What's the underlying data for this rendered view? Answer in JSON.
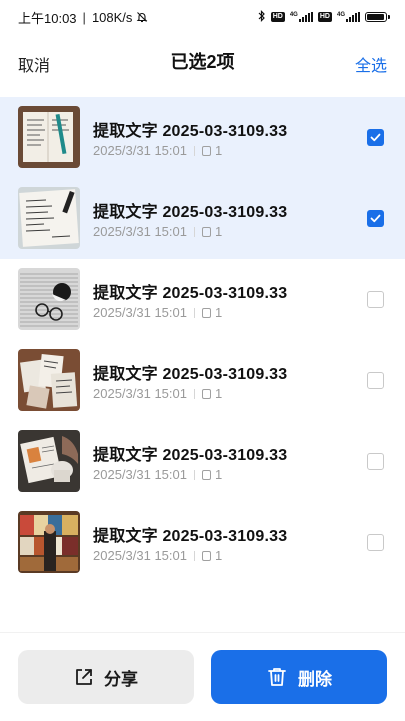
{
  "status_bar": {
    "time": "上午10:03",
    "network_speed": "108K/s",
    "icons": [
      "mute-bell-icon",
      "bluetooth-icon",
      "hd-icon",
      "signal-icon",
      "hd-icon",
      "signal-icon",
      "battery-icon"
    ],
    "signal_label": "4G"
  },
  "header": {
    "cancel_label": "取消",
    "title": "已选2项",
    "select_all_label": "全选",
    "accent_color": "#1a6fe8"
  },
  "items": [
    {
      "title": "提取文字 2025-03-3109.33",
      "date": "2025/3/31 15:01",
      "pages": "1",
      "selected": true,
      "thumb": "notebook-photo"
    },
    {
      "title": "提取文字 2025-03-3109.33",
      "date": "2025/3/31 15:01",
      "pages": "1",
      "selected": true,
      "thumb": "handwritten-notes-photo"
    },
    {
      "title": "提取文字 2025-03-3109.33",
      "date": "2025/3/31 15:01",
      "pages": "1",
      "selected": false,
      "thumb": "newspaper-glasses-photo"
    },
    {
      "title": "提取文字 2025-03-3109.33",
      "date": "2025/3/31 15:01",
      "pages": "1",
      "selected": false,
      "thumb": "magazines-photo"
    },
    {
      "title": "提取文字 2025-03-3109.33",
      "date": "2025/3/31 15:01",
      "pages": "1",
      "selected": false,
      "thumb": "reading-photo"
    },
    {
      "title": "提取文字 2025-03-3109.33",
      "date": "2025/3/31 15:01",
      "pages": "1",
      "selected": false,
      "thumb": "newsstand-photo"
    }
  ],
  "actions": {
    "share_label": "分享",
    "delete_label": "删除"
  }
}
